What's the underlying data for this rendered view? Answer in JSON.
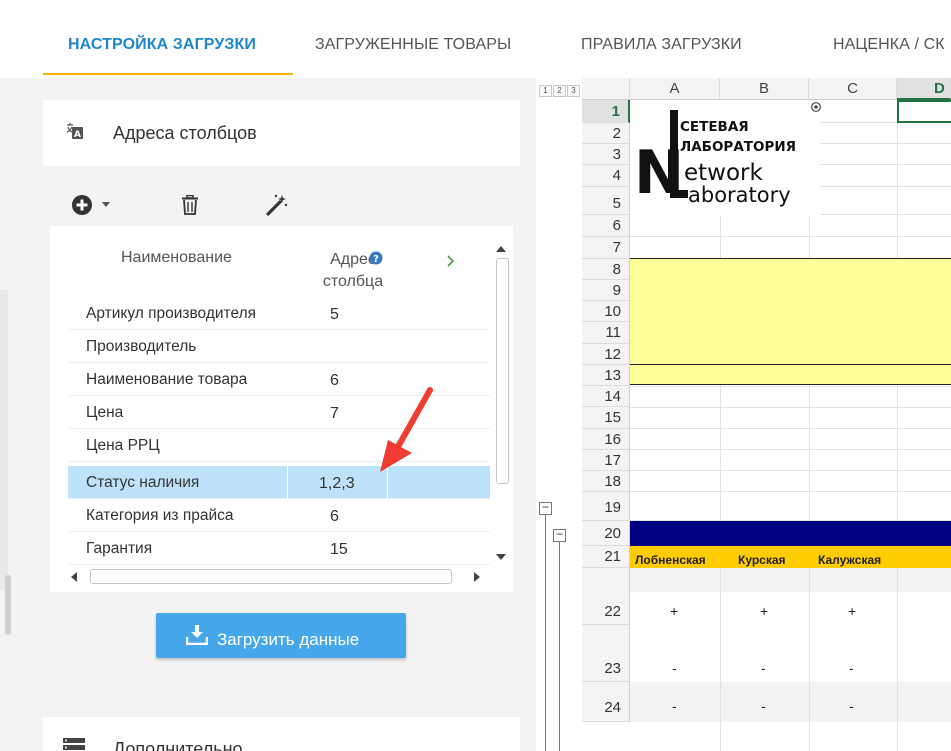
{
  "tabs": [
    {
      "label": "НАСТРОЙКА ЗАГРУЗКИ",
      "active": true
    },
    {
      "label": "ЗАГРУЖЕННЫЕ ТОВАРЫ",
      "active": false
    },
    {
      "label": "ПРАВИЛА ЗАГРУЗКИ",
      "active": false
    },
    {
      "label": "НАЦЕНКА / СК",
      "active": false
    }
  ],
  "column_panel": {
    "title": "Адреса столбцов",
    "toolbar": {
      "add_icon": "plus-circle-icon",
      "delete_icon": "trash-icon",
      "magic_icon": "magic-wand-icon"
    },
    "grid": {
      "header_name": "Наименование",
      "header_address": "Адрес столбца",
      "rows": [
        {
          "name": "Артикул производителя",
          "address": "5"
        },
        {
          "name": "Производитель",
          "address": ""
        },
        {
          "name": "Наименование товара",
          "address": "6"
        },
        {
          "name": "Цена",
          "address": "7"
        },
        {
          "name": "Цена РРЦ",
          "address": ""
        },
        {
          "name": "Статус наличия",
          "address": "1,2,3"
        },
        {
          "name": "Категория из прайса",
          "address": "6"
        },
        {
          "name": "Гарантия",
          "address": "15"
        }
      ],
      "selected_row": 5
    },
    "upload_button": "Загрузить данные"
  },
  "additional_section": {
    "title": "Дополнительно"
  },
  "spreadsheet": {
    "outline_levels": [
      "1",
      "2",
      "3"
    ],
    "columns": [
      "A",
      "B",
      "C",
      "D"
    ],
    "active_column": "D",
    "rows": [
      "1",
      "2",
      "3",
      "4",
      "5",
      "6",
      "7",
      "8",
      "9",
      "10",
      "11",
      "12",
      "13",
      "14",
      "15",
      "16",
      "17",
      "18",
      "19",
      "20",
      "21",
      "22",
      "23",
      "24"
    ],
    "active_row": "1",
    "logo_lines": [
      "СЕТЕВАЯ",
      "ЛАБОРАТОРИЯ",
      "etwork",
      "aboratory"
    ],
    "logo_letters": [
      "N",
      "L"
    ],
    "row21_cells": [
      "Лобненская",
      "Курская",
      "Калужская"
    ],
    "row22_cells": [
      "+",
      "+",
      "+"
    ],
    "row23_cells": [
      "-",
      "-",
      "-"
    ],
    "row24_cells": [
      "-",
      "-",
      "-"
    ],
    "colors": {
      "yellow_band": "#ffff99",
      "navy_band": "#000080",
      "gold_band": "#ffcc00",
      "active_green": "#217346"
    }
  }
}
